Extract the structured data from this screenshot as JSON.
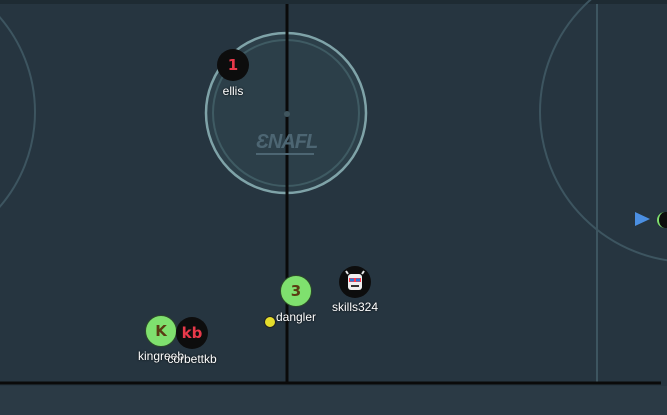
{
  "logo_text": "ƐNAFL",
  "players": [
    {
      "id": "ellis",
      "badge": "1",
      "name": "ellis",
      "style": "dark"
    },
    {
      "id": "dangler",
      "badge": "3",
      "name": "dangler",
      "style": "green"
    },
    {
      "id": "skills324",
      "badge": "",
      "name": "skills324",
      "style": "avatar"
    },
    {
      "id": "kingreeb",
      "badge": "K",
      "name": "kingreeb",
      "style": "green"
    },
    {
      "id": "corbettkb",
      "badge": "kb",
      "name": "corbettkb",
      "style": "dark"
    }
  ],
  "colors": {
    "ice": "#263540",
    "line": "#0a0a0a",
    "circle": "#7fa3a8",
    "puck": "#e5dd2c",
    "arrow": "#4b8fe2"
  }
}
